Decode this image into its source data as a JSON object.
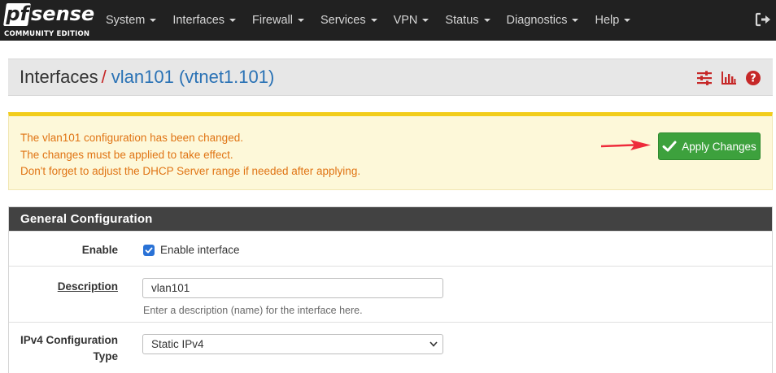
{
  "brand": {
    "logo_prefix": "pf",
    "logo_suffix": "sense",
    "edition": "COMMUNITY EDITION"
  },
  "nav": {
    "items": [
      {
        "label": "System"
      },
      {
        "label": "Interfaces"
      },
      {
        "label": "Firewall"
      },
      {
        "label": "Services"
      },
      {
        "label": "VPN"
      },
      {
        "label": "Status"
      },
      {
        "label": "Diagnostics"
      },
      {
        "label": "Help"
      }
    ],
    "logout_icon": "logout-icon"
  },
  "breadcrumb": {
    "root": "Interfaces",
    "separator": "/",
    "leaf": "vlan101 (vtnet1.101)",
    "icons": [
      "sliders-icon",
      "bar-chart-icon",
      "help-icon"
    ]
  },
  "alert": {
    "lines": [
      "The vlan101 configuration has been changed.",
      "The changes must be applied to take effect.",
      "Don't forget to adjust the DHCP Server range if needed after applying."
    ],
    "apply_label": "Apply Changes",
    "arrow_icon": "red-arrow-icon"
  },
  "panel": {
    "title": "General Configuration",
    "enable": {
      "label": "Enable",
      "checkbox_label": "Enable interface",
      "checked": true
    },
    "description": {
      "label": "Description",
      "value": "vlan101",
      "help": "Enter a description (name) for the interface here."
    },
    "ipv4": {
      "label": "IPv4 Configuration Type",
      "selected": "Static IPv4"
    }
  },
  "colors": {
    "navbar": "#212121",
    "accent_red": "#c62828",
    "link_blue": "#2a72b5",
    "alert_text": "#e07414",
    "alert_bg": "#fdf8d9",
    "alert_border": "#f2cd1b",
    "apply_green": "#3da13d",
    "panel_head": "#424242"
  }
}
